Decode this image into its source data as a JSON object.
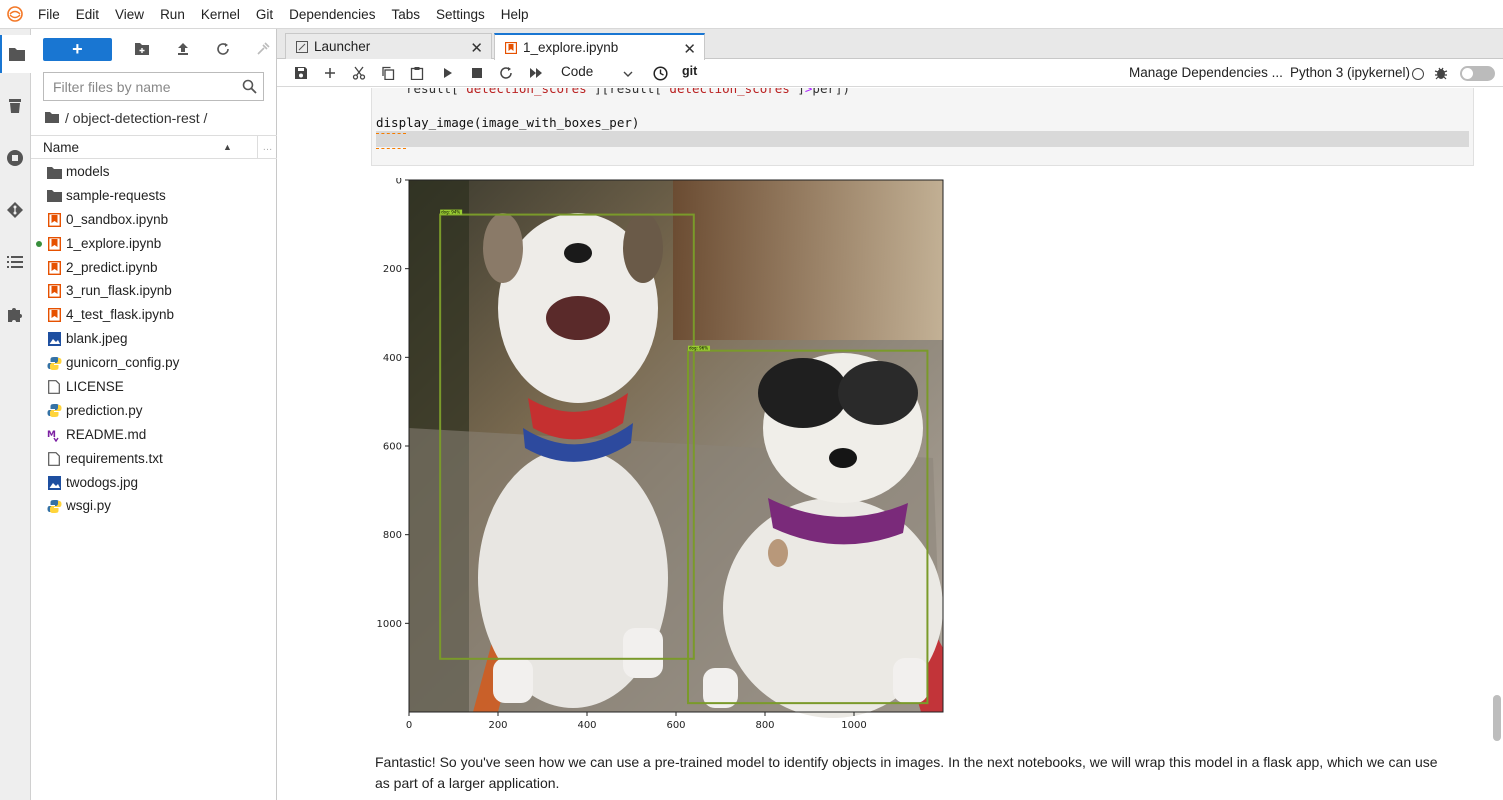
{
  "menubar": {
    "items": [
      "File",
      "Edit",
      "View",
      "Run",
      "Kernel",
      "Git",
      "Dependencies",
      "Tabs",
      "Settings",
      "Help"
    ]
  },
  "activitybar": {
    "icons": [
      "folder-icon",
      "trash-icon",
      "running-icon",
      "git-icon",
      "toc-icon",
      "extension-icon"
    ]
  },
  "filebrowser": {
    "new_label": "+",
    "search_placeholder": "Filter files by name",
    "breadcrumb": "/ object-detection-rest /",
    "column_name": "Name",
    "items": [
      {
        "name": "models",
        "type": "folder"
      },
      {
        "name": "sample-requests",
        "type": "folder"
      },
      {
        "name": "0_sandbox.ipynb",
        "type": "notebook"
      },
      {
        "name": "1_explore.ipynb",
        "type": "notebook",
        "running": true
      },
      {
        "name": "2_predict.ipynb",
        "type": "notebook"
      },
      {
        "name": "3_run_flask.ipynb",
        "type": "notebook"
      },
      {
        "name": "4_test_flask.ipynb",
        "type": "notebook"
      },
      {
        "name": "blank.jpeg",
        "type": "image"
      },
      {
        "name": "gunicorn_config.py",
        "type": "python"
      },
      {
        "name": "LICENSE",
        "type": "file"
      },
      {
        "name": "prediction.py",
        "type": "python"
      },
      {
        "name": "README.md",
        "type": "markdown"
      },
      {
        "name": "requirements.txt",
        "type": "file"
      },
      {
        "name": "twodogs.jpg",
        "type": "image"
      },
      {
        "name": "wsgi.py",
        "type": "python"
      }
    ]
  },
  "tabs": [
    {
      "label": "Launcher",
      "active": false
    },
    {
      "label": "1_explore.ipynb",
      "active": true
    }
  ],
  "toolbar": {
    "cell_type": "Code",
    "git_label": "git",
    "manage_deps": "Manage Dependencies ...",
    "kernel": "Python 3 (ipykernel)"
  },
  "cell": {
    "line1_a": "result[",
    "line1_b": "'detection_scores'",
    "line1_c": "][result[",
    "line1_d": "'detection_scores'",
    "line1_e": "]",
    "line1_f": ">",
    "line1_g": "per])",
    "line2": "display_image(image_with_boxes_per)"
  },
  "chart_data": {
    "type": "image",
    "xticks": [
      0,
      200,
      400,
      600,
      800,
      1000
    ],
    "yticks": [
      0,
      200,
      400,
      600,
      800,
      1000
    ],
    "xlim": [
      0,
      1200
    ],
    "ylim": [
      1200,
      0
    ],
    "detections": [
      {
        "label": "dog: 94%",
        "x0": 70,
        "y0": 78,
        "x1": 640,
        "y1": 1080
      },
      {
        "label": "dog: 96%",
        "x0": 627,
        "y0": 385,
        "x1": 1165,
        "y1": 1180
      }
    ]
  },
  "markdown": {
    "text": "Fantastic! So you've seen how we can use a pre-trained model to identify objects in images. In the next notebooks, we will wrap this model in a flask app, which we can use as part of a larger application."
  },
  "colors": {
    "accent": "#1976d2",
    "notebook_icon": "#e65100",
    "python_blue": "#3572a5",
    "python_yellow": "#ffd43b",
    "box": "#7a9a2a"
  }
}
